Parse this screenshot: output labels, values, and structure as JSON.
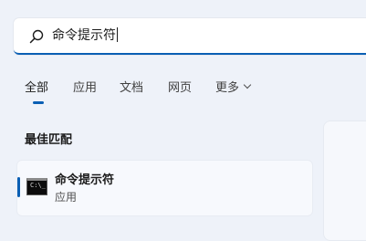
{
  "search": {
    "query": "命令提示符"
  },
  "tabs": [
    {
      "label": "全部"
    },
    {
      "label": "应用"
    },
    {
      "label": "文档"
    },
    {
      "label": "网页"
    },
    {
      "label": "更多"
    }
  ],
  "best_match": {
    "heading": "最佳匹配",
    "result": {
      "name": "命令提示符",
      "type": "应用",
      "icon": "command-prompt-icon"
    }
  },
  "colors": {
    "accent": "#0a5fb4",
    "background": "#eef2f9",
    "card": "#f7f9fd"
  }
}
